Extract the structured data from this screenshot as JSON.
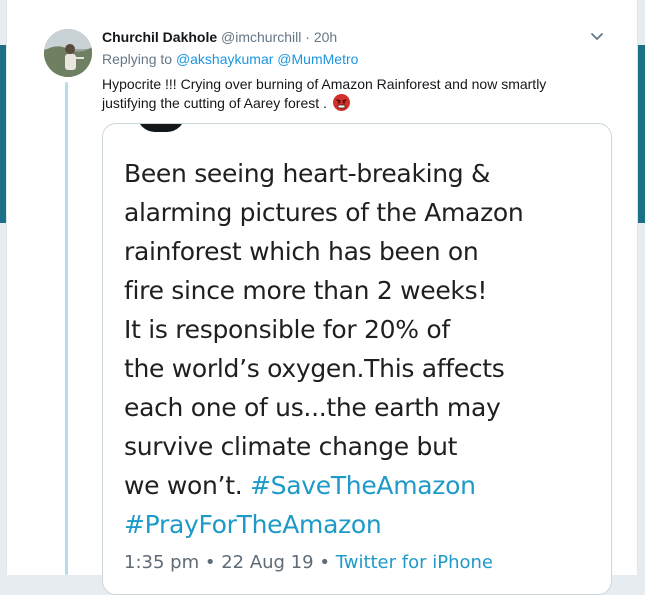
{
  "tweet": {
    "display_name": "Churchil Dakhole",
    "handle": "@imchurchill",
    "separator": "·",
    "time": "20h",
    "replying_to_label": "Replying to",
    "mentions": [
      "@akshaykumar",
      "@MumMetro"
    ],
    "text_line1": "Hypocrite !!! Crying over burning of  Amazon Rainforest and now smartly",
    "text_line2": "justifying the cutting of Aarey forest .",
    "emoji_name": "angry-face-emoji"
  },
  "embedded_image": {
    "lines": [
      "Been seeing heart-breaking &",
      "alarming pictures of the Amazon",
      "rainforest which has been on",
      "fire since more than 2 weeks!",
      "It is responsible for 20% of",
      "the world’s oxygen.This affects",
      "each one of us...the earth may",
      "survive climate change but"
    ],
    "last_line_text": "we won’t.",
    "hashtag1": "#SaveTheAmazon",
    "hashtag2": "#PrayForTheAmazon",
    "timestamp": "1:35 pm",
    "meta_sep1": "•",
    "date": "22 Aug 19",
    "meta_sep2": "•",
    "source": "Twitter for iPhone"
  },
  "colors": {
    "link": "#1b95e0",
    "hashtag": "#1d9ac8",
    "thread_line": "#b5dcee",
    "background_band": "#1b6f86"
  }
}
